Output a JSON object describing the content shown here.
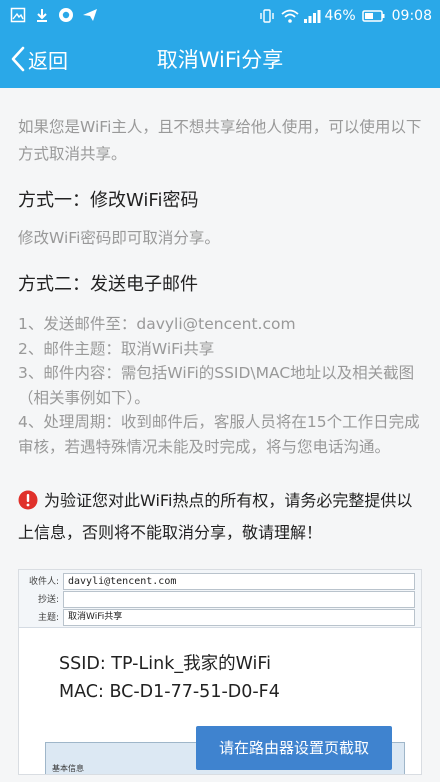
{
  "statusbar": {
    "battery_percent": "46%",
    "time": "09:08"
  },
  "navbar": {
    "back_label": "返回",
    "title": "取消WiFi分享"
  },
  "content": {
    "intro": "如果您是WiFi主人，且不想共享给他人使用，可以使用以下方式取消共享。",
    "method1_title": "方式一：修改WiFi密码",
    "method1_desc": "修改WiFi密码即可取消分享。",
    "method2_title": "方式二：发送电子邮件",
    "method2_items": [
      "1、发送邮件至：davyli@tencent.com",
      "2、邮件主题：取消WiFi共享",
      "3、邮件内容：需包括WiFi的SSID\\MAC地址以及相关截图（相关事例如下）。",
      "4、处理周期：收到邮件后，客服人员将在15个工作日完成审核，若遇特殊情况未能及时完成，将与您电话沟通。"
    ],
    "warning": "为验证您对此WiFi热点的所有权，请务必完整提供以上信息，否则将不能取消分享，敬请理解！"
  },
  "example": {
    "to_label": "收件人:",
    "to_value": "davyli@tencent.com",
    "cc_label": "抄送:",
    "cc_value": "",
    "subject_label": "主题:",
    "subject_value": "取消WiFi共享",
    "ssid_line": "SSID: TP-Link_我家的WiFi",
    "mac_line": "MAC: BC-D1-77-51-D0-F4",
    "panel_label": "基本信息",
    "callout": "请在路由器设置页截取"
  },
  "colors": {
    "accent": "#2aa8e8",
    "warning": "#e0312b"
  },
  "icons": [
    "image-icon",
    "download-icon",
    "app-icon",
    "send-icon",
    "vibrate-icon",
    "wifi-icon",
    "signal-icon",
    "battery-icon",
    "back-chevron-icon",
    "exclamation-icon"
  ]
}
